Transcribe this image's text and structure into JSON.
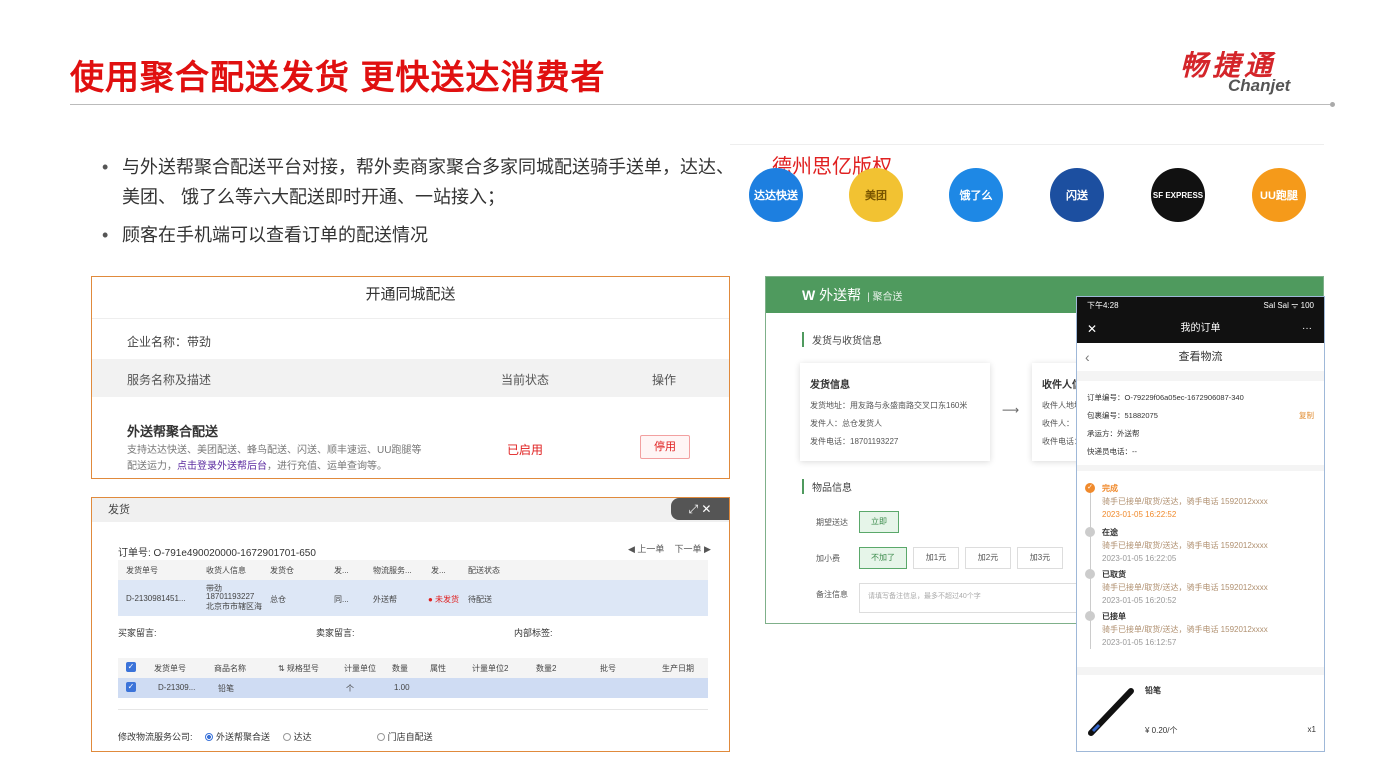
{
  "slide": {
    "title": "使用聚合配送发货 更快送达消费者",
    "logo_cn": "畅捷通",
    "logo_en": "Chanjet",
    "watermark": "德州思亿版权"
  },
  "bullets": [
    "与外送帮聚合配送平台对接，帮外卖商家聚合多家同城配送骑手送单，达达、 美团、 饿了么等六大配送即时开通、一站接入；",
    "顾客在手机端可以查看订单的配送情况"
  ],
  "couriers": [
    {
      "name": "达达快送",
      "color": "#1d7fe0"
    },
    {
      "name": "美团",
      "color": "#f2c232"
    },
    {
      "name": "饿了么",
      "color": "#1e88e5"
    },
    {
      "name": "闪送",
      "color": "#1c4fa0"
    },
    {
      "name": "SF EXPRESS",
      "color": "#111111"
    },
    {
      "name": "UU跑腿",
      "color": "#f59a1a"
    }
  ],
  "activate_panel": {
    "title": "开通同城配送",
    "company": "企业名称：带劲",
    "col_service": "服务名称及描述",
    "col_status": "当前状态",
    "col_action": "操作",
    "service_name": "外送帮聚合配送",
    "desc_a": "支持达达快送、美团配送、蜂鸟配送、闪送、顺丰速运、UU跑腿等配送运力，",
    "desc_link": "点击登录外送帮后台",
    "desc_b": "，进行充值、运单查询等。",
    "status": "已启用",
    "action": "停用"
  },
  "ship_panel": {
    "title": "发货",
    "order_no": "订单号: O-791e490020000-1672901701-650",
    "prev": "◀ 上一单",
    "next": "下一单 ▶",
    "t1_headers": [
      "发货单号",
      "收货人信息",
      "发货仓",
      "发...",
      "物流服务...",
      "发...",
      "配送状态"
    ],
    "t1_row": [
      "D-2130981451...",
      "带劲",
      "18701193227",
      "北京市市辖区海",
      "总仓",
      "同...",
      "外送帮",
      "● 未发货",
      "待配送"
    ],
    "buyer_note": "买家留言:",
    "seller_note": "卖家留言:",
    "inner_tag": "内部标签:",
    "t2_headers": [
      "发货单号",
      "商品名称",
      "⇅ 规格型号",
      "计量单位",
      "数量",
      "属性",
      "计量单位2",
      "数量2",
      "批号",
      "生产日期"
    ],
    "t2_row": [
      "D-21309...",
      "铅笔",
      "个",
      "1.00"
    ],
    "ship_label": "修改物流服务公司:",
    "ship_options": [
      "外送帮聚合送",
      "达达",
      "门店自配送"
    ]
  },
  "wsb_panel": {
    "brand": "外送帮",
    "brand_sub": "| 聚合送",
    "sec1": "发货与收货信息",
    "sender_title": "发货信息",
    "sender_addr": "发货地址：用友路与永盛南路交叉口东160米",
    "sender_name": "发件人：总仓发货人",
    "sender_phone": "发件电话：18701193227",
    "recv_title": "收件人信息",
    "recv_addr": "收件人地址",
    "recv_name": "收件人：",
    "recv_phone": "收件电话：",
    "sec2": "物品信息",
    "expect_label": "期望送达",
    "expect_value": "立即",
    "tip_label": "加小费",
    "tips": [
      "不加了",
      "加1元",
      "加2元",
      "加3元"
    ],
    "note_label": "备注信息",
    "note_placeholder": "请填写备注信息，最多不超过40个字"
  },
  "phone": {
    "time": "下午4:28",
    "signal": "Sal Sal ᯤ 100",
    "title": "我的订单",
    "subtitle": "查看物流",
    "order_no": "订单编号：O-79229f06a05ec-1672906087-340",
    "waybill": "包裹编号：51882075",
    "carrier": "承运方：外送帮",
    "courier_phone": "快递员电话：--",
    "copy": "复制",
    "events": [
      {
        "status": "完成",
        "time": "2023-01-05 16:22:52"
      },
      {
        "status": "在途",
        "time": "2023-01-05 16:22:05"
      },
      {
        "status": "已取货",
        "time": "2023-01-05 16:20:52"
      },
      {
        "status": "已接单",
        "time": "2023-01-05 16:12:57"
      }
    ],
    "event_desc": "骑手已接单/取货/送达，骑手电话 1592012xxxx",
    "product": "铅笔",
    "price": "¥ 0.20/个",
    "qty": "x1"
  }
}
